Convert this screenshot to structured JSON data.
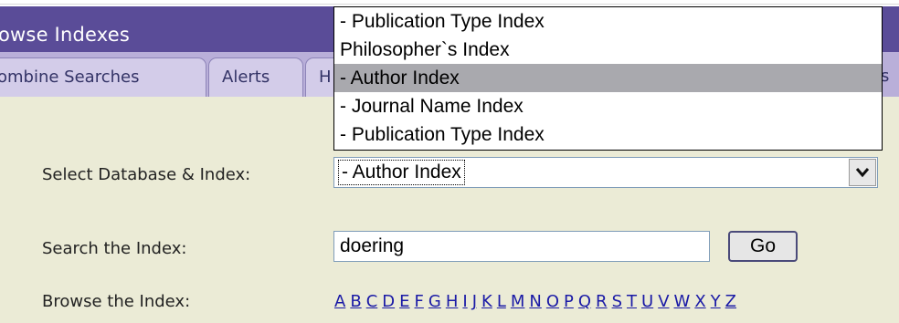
{
  "header": {
    "title": "owse Indexes"
  },
  "tabs": [
    {
      "label": "ombine Searches"
    },
    {
      "label": "Alerts"
    },
    {
      "label": "H"
    }
  ],
  "tab_right_fragment": "s",
  "form": {
    "select_label": "Select Database & Index:",
    "select_value": "- Author Index",
    "search_label": "Search the Index:",
    "search_value": "doering",
    "go_label": "Go",
    "browse_label": "Browse the Index:"
  },
  "dropdown_options": [
    {
      "label": "- Publication Type Index"
    },
    {
      "label": "Philosopher`s Index"
    },
    {
      "label": "- Author Index"
    },
    {
      "label": "- Journal Name Index"
    },
    {
      "label": "- Publication Type Index"
    }
  ],
  "letters": [
    "A",
    "B",
    "C",
    "D",
    "E",
    "F",
    "G",
    "H",
    "I",
    "J",
    "K",
    "L",
    "M",
    "N",
    "O",
    "P",
    "Q",
    "R",
    "S",
    "T",
    "U",
    "V",
    "W",
    "X",
    "Y",
    "Z"
  ],
  "colors": {
    "header_bg": "#5a4c98",
    "tab_strip_bg": "#b9afd9",
    "content_bg": "#ebebd6",
    "link": "#1a1aa6",
    "dropdown_highlight": "#a9a9ae"
  }
}
